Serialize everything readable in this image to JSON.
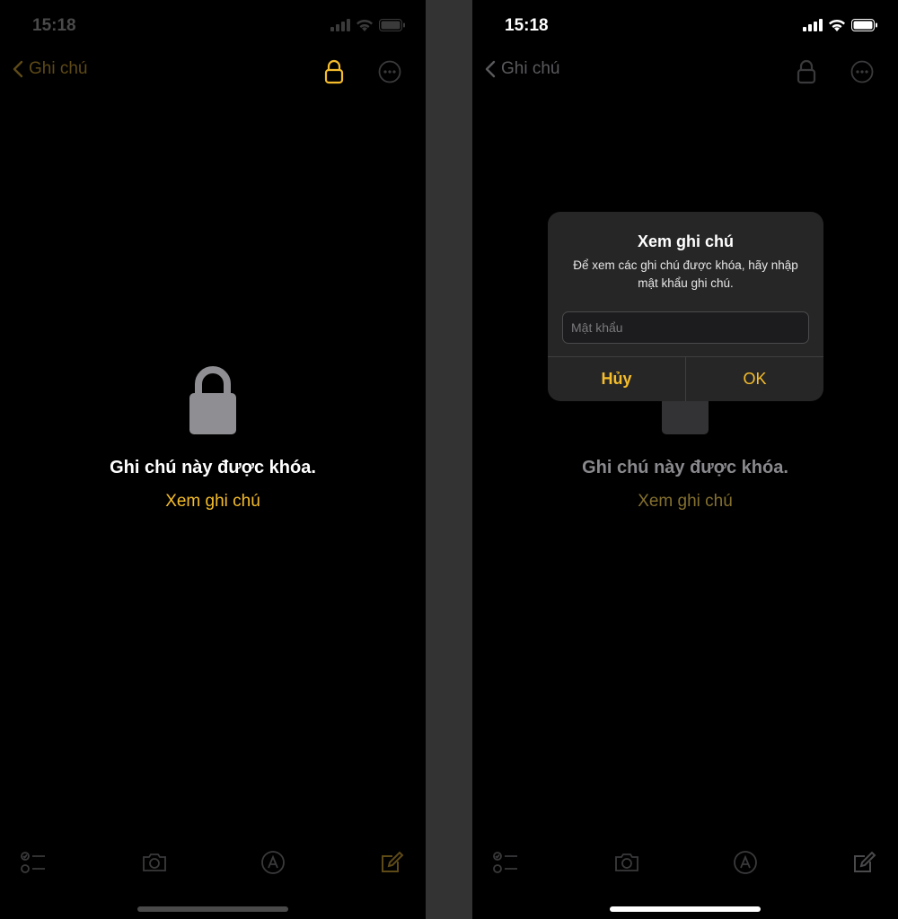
{
  "colors": {
    "accent": "#f5bd2c",
    "accent_dim": "#5e4a17",
    "accent_dim2": "#84702f",
    "icon_dim": "#3a3a3c",
    "lock_gray": "#8e8e93",
    "lock_dim": "#333335"
  },
  "left": {
    "status": {
      "time": "15:18"
    },
    "nav": {
      "back_label": "Ghi chú"
    },
    "content": {
      "locked_text": "Ghi chú này được khóa.",
      "view_link": "Xem ghi chú"
    }
  },
  "right": {
    "status": {
      "time": "15:18"
    },
    "nav": {
      "back_label": "Ghi chú"
    },
    "content": {
      "locked_text": "Ghi chú này được khóa.",
      "view_link": "Xem ghi chú"
    },
    "dialog": {
      "title": "Xem ghi chú",
      "message": "Để xem các ghi chú được khóa, hãy nhập mật khẩu ghi chú.",
      "password_placeholder": "Mật khẩu",
      "cancel_label": "Hủy",
      "ok_label": "OK"
    }
  },
  "icons": [
    "chevron-left-icon",
    "lock-icon",
    "more-icon",
    "checklist-icon",
    "camera-icon",
    "markup-icon",
    "compose-icon",
    "cellular-signal-icon",
    "wifi-icon",
    "battery-icon"
  ]
}
